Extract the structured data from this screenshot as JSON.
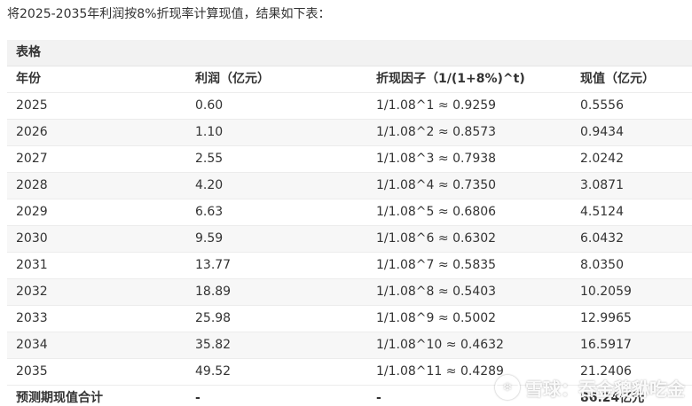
{
  "intro": "将2025-2035年利润按8%折现率计算现值，结果如下表：",
  "table": {
    "caption": "表格",
    "headers": [
      "年份",
      "利润（亿元）",
      "折现因子（1/(1+8%)^t)",
      "现值（亿元）"
    ],
    "rows": [
      [
        "2025",
        "0.60",
        "1/1.08^1 ≈ 0.9259",
        "0.5556"
      ],
      [
        "2026",
        "1.10",
        "1/1.08^2 ≈ 0.8573",
        "0.9434"
      ],
      [
        "2027",
        "2.55",
        "1/1.08^3 ≈ 0.7938",
        "2.0242"
      ],
      [
        "2028",
        "4.20",
        "1/1.08^4 ≈ 0.7350",
        "3.0871"
      ],
      [
        "2029",
        "6.63",
        "1/1.08^5 ≈ 0.6806",
        "4.5124"
      ],
      [
        "2030",
        "9.59",
        "1/1.08^6 ≈ 0.6302",
        "6.0432"
      ],
      [
        "2031",
        "13.77",
        "1/1.08^7 ≈ 0.5835",
        "8.0350"
      ],
      [
        "2032",
        "18.89",
        "1/1.08^8 ≈ 0.5403",
        "10.2059"
      ],
      [
        "2033",
        "25.98",
        "1/1.08^9 ≈ 0.5002",
        "12.9965"
      ],
      [
        "2034",
        "35.82",
        "1/1.08^10 ≈ 0.4632",
        "16.5917"
      ],
      [
        "2035",
        "49.52",
        "1/1.08^11 ≈ 0.4289",
        "21.2406"
      ]
    ],
    "total": [
      "预测期现值合计",
      "-",
      "-",
      "86.24亿元"
    ]
  },
  "watermark": {
    "icon": "snowball-icon",
    "text": "雪球：吞金貔貅吃金"
  }
}
